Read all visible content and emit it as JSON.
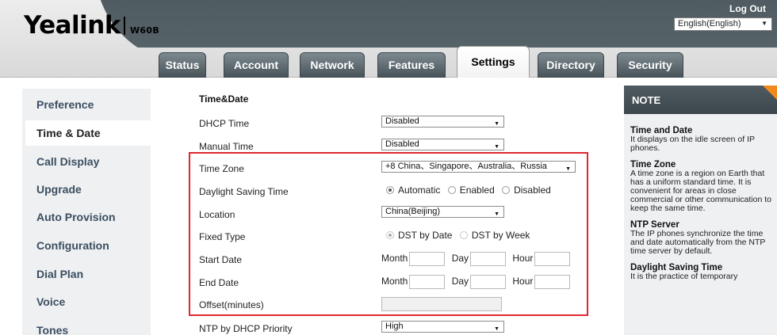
{
  "header": {
    "logo_text": "Yealink",
    "model": "W60B",
    "logout": "Log Out",
    "language": "English(English)"
  },
  "tabs": [
    {
      "label": "Status"
    },
    {
      "label": "Account"
    },
    {
      "label": "Network"
    },
    {
      "label": "Features"
    },
    {
      "label": "Settings"
    },
    {
      "label": "Directory"
    },
    {
      "label": "Security"
    }
  ],
  "sidebar": {
    "items": [
      {
        "label": "Preference"
      },
      {
        "label": "Time & Date"
      },
      {
        "label": "Call Display"
      },
      {
        "label": "Upgrade"
      },
      {
        "label": "Auto Provision"
      },
      {
        "label": "Configuration"
      },
      {
        "label": "Dial Plan"
      },
      {
        "label": "Voice"
      },
      {
        "label": "Tones"
      }
    ]
  },
  "form": {
    "section_title": "Time&Date",
    "dhcp_time": {
      "label": "DHCP Time",
      "value": "Disabled"
    },
    "manual_time": {
      "label": "Manual Time",
      "value": "Disabled"
    },
    "time_zone": {
      "label": "Time Zone",
      "value": "+8 China、Singapore、Australia、Russia"
    },
    "dst": {
      "label": "Daylight Saving Time",
      "options": [
        "Automatic",
        "Enabled",
        "Disabled"
      ],
      "selected": "Automatic"
    },
    "location": {
      "label": "Location",
      "value": "China(Beijing)"
    },
    "fixed_type": {
      "label": "Fixed Type",
      "options": [
        "DST by Date",
        "DST by Week"
      ],
      "selected": "DST by Date"
    },
    "start_date": {
      "label": "Start Date",
      "month": "Month",
      "day": "Day",
      "hour": "Hour"
    },
    "end_date": {
      "label": "End Date",
      "month": "Month",
      "day": "Day",
      "hour": "Hour"
    },
    "offset": {
      "label": "Offset(minutes)",
      "value": ""
    },
    "ntp_priority": {
      "label": "NTP by DHCP Priority",
      "value": "High"
    }
  },
  "note": {
    "title": "NOTE",
    "sections": [
      {
        "heading": "Time and Date",
        "text": "It displays on the idle screen of IP phones."
      },
      {
        "heading": "Time Zone",
        "text": "A time zone is a region on Earth that has a uniform standard time. It is convenient for areas in close commercial or other communication to keep the same time."
      },
      {
        "heading": "NTP Server",
        "text": "The IP phones synchronize the time and date automatically from the NTP time server by default."
      },
      {
        "heading": "Daylight Saving Time",
        "text": "It is the practice of temporary"
      }
    ]
  }
}
